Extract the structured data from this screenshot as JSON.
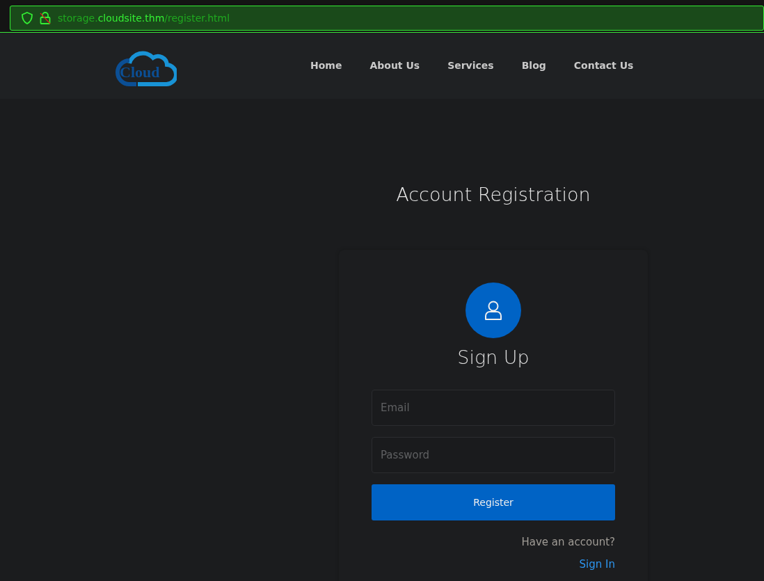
{
  "browser": {
    "url_prefix": "storage.",
    "url_host": "cloudsite.thm",
    "url_path": "/register.html"
  },
  "logo": {
    "text": "Cloud"
  },
  "nav": [
    {
      "label": "Home"
    },
    {
      "label": "About Us"
    },
    {
      "label": "Services"
    },
    {
      "label": "Blog"
    },
    {
      "label": "Contact Us"
    }
  ],
  "page_title": "Account Registration",
  "form": {
    "heading": "Sign Up",
    "fields": [
      {
        "placeholder": "Email"
      },
      {
        "placeholder": "Password"
      }
    ],
    "button": "Register",
    "prompt": "Have an account?",
    "link": "Sign In"
  }
}
